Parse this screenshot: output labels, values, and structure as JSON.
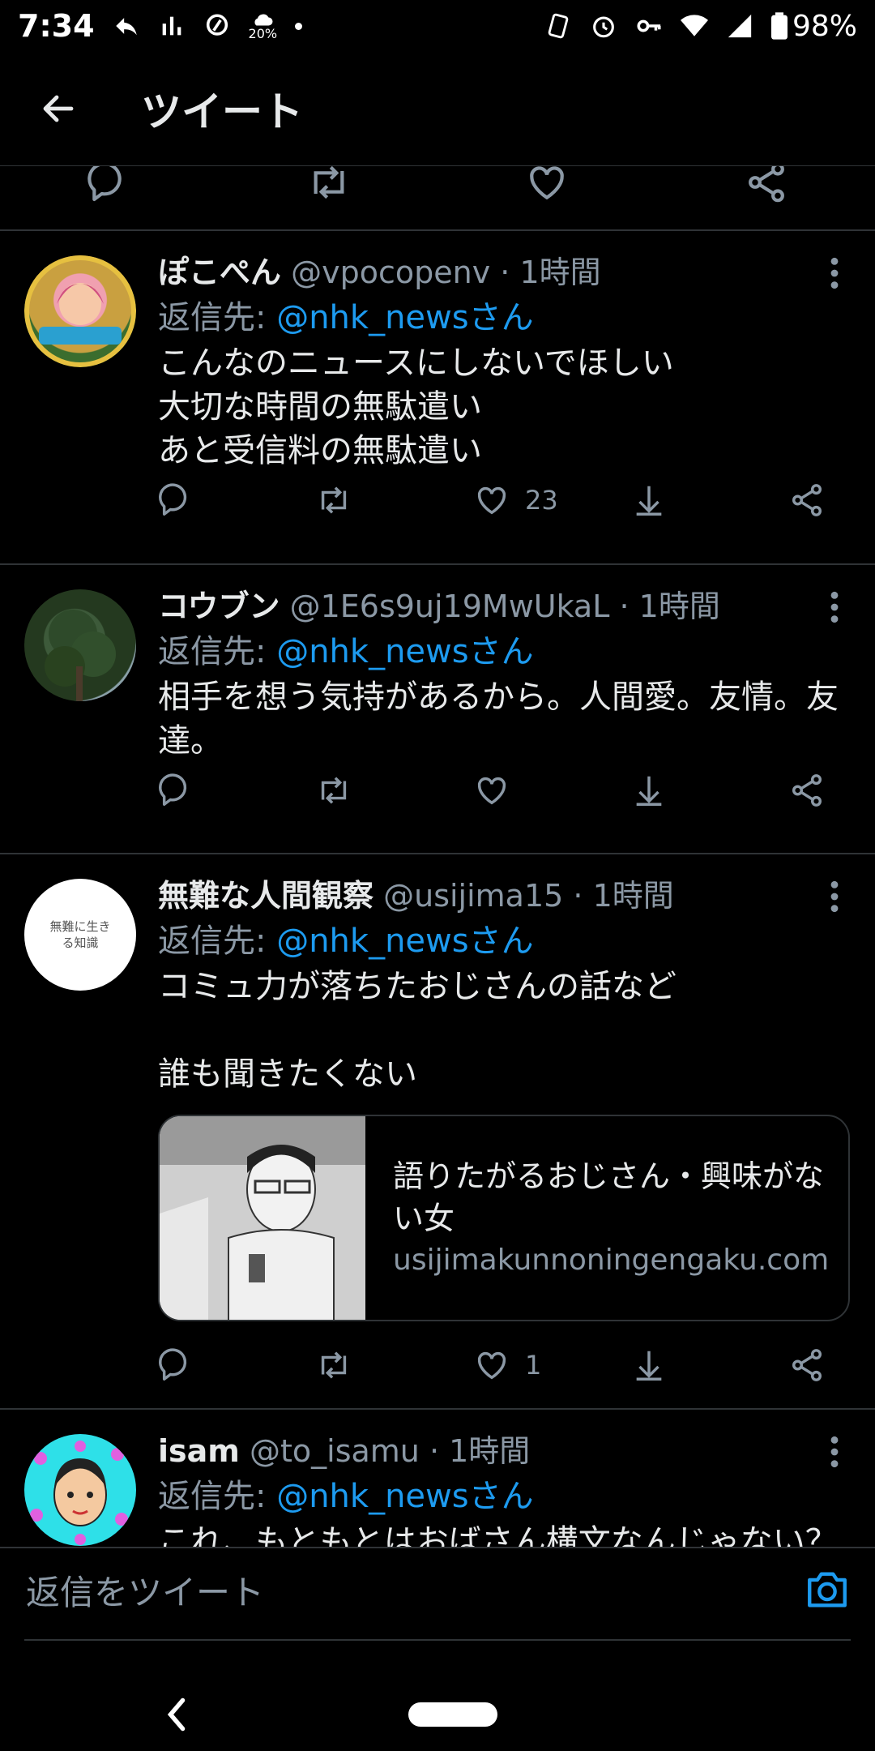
{
  "status_bar": {
    "time": "7:34",
    "weather_percent": "20%",
    "battery": "98%"
  },
  "header": {
    "title": "ツイート"
  },
  "tweets": [
    {
      "name": "ぽこぺん",
      "handle": "@vpocopenv",
      "time": "1時間",
      "reply_prefix": "返信先: ",
      "reply_to": "@nhk_newsさん",
      "text": "こんなのニュースにしないでほしい\n大切な時間の無駄遣い\nあと受信料の無駄遣い",
      "like_count": "23"
    },
    {
      "name": "コウブン",
      "handle": "@1E6s9uj19MwUkaL",
      "time": "1時間",
      "reply_prefix": "返信先: ",
      "reply_to": "@nhk_newsさん",
      "text": "相手を想う気持があるから。人間愛。友情。友\n達。",
      "like_count": ""
    },
    {
      "name": "無難な人間観察",
      "handle": "@usijima15",
      "time": "1時間",
      "reply_prefix": "返信先: ",
      "reply_to": "@nhk_newsさん",
      "text": "コミュ力が落ちたおじさんの話など\n\n誰も聞きたくない",
      "avatar_text": "無難に生きる知識",
      "card": {
        "title": "語りたがるおじさん・興味がない女",
        "domain": "usijimakunnoningengaku.com"
      },
      "like_count": "1"
    },
    {
      "name": "isam",
      "handle": "@to_isamu",
      "time": "1時間",
      "reply_prefix": "返信先: ",
      "reply_to": "@nhk_newsさん",
      "text": "これ、もともとはおばさん構文なんじゃない？"
    }
  ],
  "separator": " · ",
  "reply_bar": {
    "placeholder": "返信をツイート"
  },
  "colors": {
    "background": "#000000",
    "accent": "#1d9bf0",
    "muted": "#8b98a5",
    "divider": "#2f3336"
  }
}
